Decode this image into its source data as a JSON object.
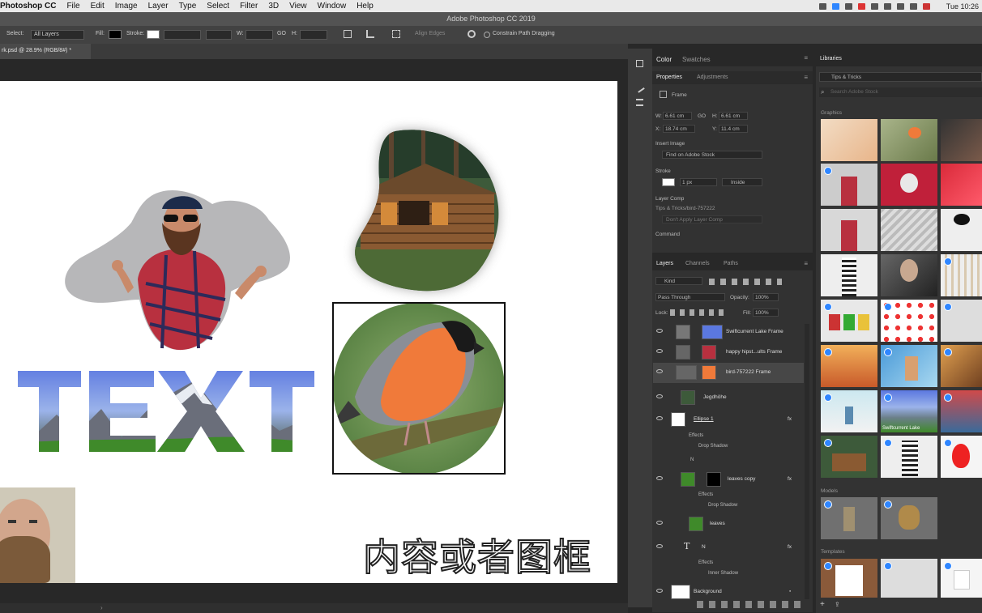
{
  "menubar": {
    "app": "Photoshop CC",
    "items": [
      "File",
      "Edit",
      "Image",
      "Layer",
      "Type",
      "Select",
      "Filter",
      "3D",
      "View",
      "Window",
      "Help"
    ],
    "clock": "Tue 10:26"
  },
  "window": {
    "title": "Adobe Photoshop CC 2019"
  },
  "options": {
    "select_label": "Select:",
    "select_value": "All Layers",
    "fill_label": "Fill:",
    "stroke_label": "Stroke:",
    "w_label": "W:",
    "go_label": "GO",
    "h_label": "H:",
    "align_edges": "Align Edges",
    "constrain": "Constrain Path Dragging"
  },
  "doc_tab": "rk.psd @ 28.9% (RGB/8#) *",
  "canvas": {
    "text_art": "TEXT",
    "subtitle": "内容或者图框"
  },
  "color_panel": {
    "tab_color": "Color",
    "tab_swatches": "Swatches"
  },
  "properties": {
    "tab_properties": "Properties",
    "tab_adjustments": "Adjustments",
    "kind": "Frame",
    "w_label": "W:",
    "w_value": "6.61 cm",
    "go_label": "GO",
    "h_label": "H:",
    "h_value": "6.61 cm",
    "x_label": "X:",
    "x_value": "18.74 cm",
    "y_label": "Y:",
    "y_value": "11.4 cm",
    "insert_image": "Insert Image",
    "insert_value": "Find on Adobe Stock",
    "stroke": "Stroke",
    "stroke_size": "1 px",
    "stroke_pos": "Inside",
    "layer_comp": "Layer Comp",
    "layer_comp_name": "Tips & Tricks/bird-757222",
    "layer_comp_value": "Don't Apply Layer Comp",
    "command": "Command"
  },
  "layers": {
    "tabs": [
      "Layers",
      "Channels",
      "Paths"
    ],
    "kind": "Kind",
    "blend": "Pass Through",
    "opacity_label": "Opacity:",
    "opacity": "100%",
    "lock_label": "Lock:",
    "fill_label": "Fill:",
    "fill": "100%",
    "rows": [
      {
        "name": "Swiftcurrent Lake Frame"
      },
      {
        "name": "happy hipst...ults Frame"
      },
      {
        "name": "bird-757222 Frame"
      },
      {
        "name": "Jegdhöhe"
      },
      {
        "name": "Ellipse 1",
        "fx": "fx"
      },
      {
        "name": "Effects"
      },
      {
        "name": "Drop Shadow"
      },
      {
        "name": "N"
      },
      {
        "name": "leaves copy",
        "fx": "fx"
      },
      {
        "name": "Effects"
      },
      {
        "name": "Drop Shadow"
      },
      {
        "name": "leaves"
      },
      {
        "name": "N",
        "fx": "fx"
      },
      {
        "name": "Effects"
      },
      {
        "name": "Inner Shadow"
      },
      {
        "name": "Background"
      }
    ]
  },
  "libraries": {
    "tab": "Libraries",
    "library_name": "Tips & Tricks",
    "search_placeholder": "Search Adobe Stock",
    "graphics": "Graphics",
    "models": "Models",
    "templates": "Templates",
    "lake_label": "Swiftcurrent Lake"
  },
  "colors": {
    "accent": "#2f86ff",
    "panel": "#323232",
    "canvas": "#ffffff"
  }
}
